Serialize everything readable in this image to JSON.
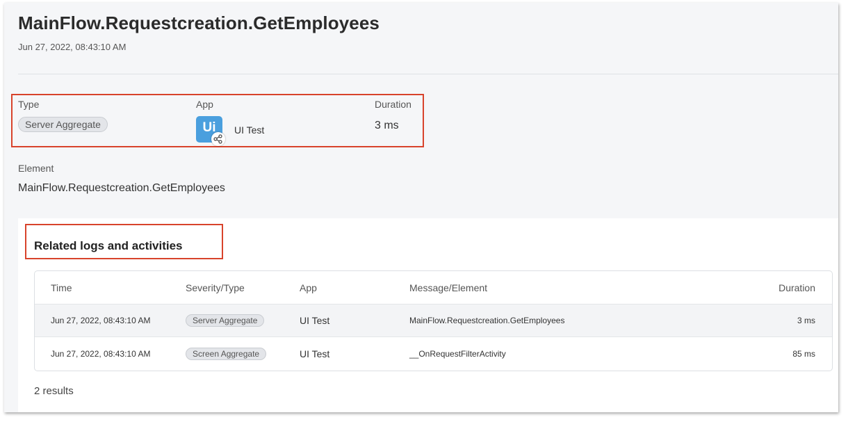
{
  "header": {
    "title": "MainFlow.Requestcreation.GetEmployees",
    "timestamp": "Jun 27, 2022, 08:43:10 AM"
  },
  "meta": {
    "type_label": "Type",
    "type_value": "Server Aggregate",
    "app_label": "App",
    "app_icon_text": "Ui",
    "app_name": "UI Test",
    "duration_label": "Duration",
    "duration_value": "3 ms",
    "element_label": "Element",
    "element_value": "MainFlow.Requestcreation.GetEmployees"
  },
  "related": {
    "title": "Related logs and activities",
    "columns": {
      "time": "Time",
      "severity": "Severity/Type",
      "app": "App",
      "message": "Message/Element",
      "duration": "Duration"
    },
    "rows": [
      {
        "time": "Jun 27, 2022, 08:43:10 AM",
        "severity": "Server Aggregate",
        "app": "UI Test",
        "message": "MainFlow.Requestcreation.GetEmployees",
        "duration": "3 ms"
      },
      {
        "time": "Jun 27, 2022, 08:43:10 AM",
        "severity": "Screen Aggregate",
        "app": "UI Test",
        "message": "__OnRequestFilterActivity",
        "duration": "85 ms"
      }
    ],
    "results": "2 results"
  },
  "colors": {
    "highlight": "#d8432b",
    "app_icon": "#4a9fde",
    "link": "#2a6fb0"
  },
  "icons": {
    "app_badge": "share-nodes-icon"
  }
}
